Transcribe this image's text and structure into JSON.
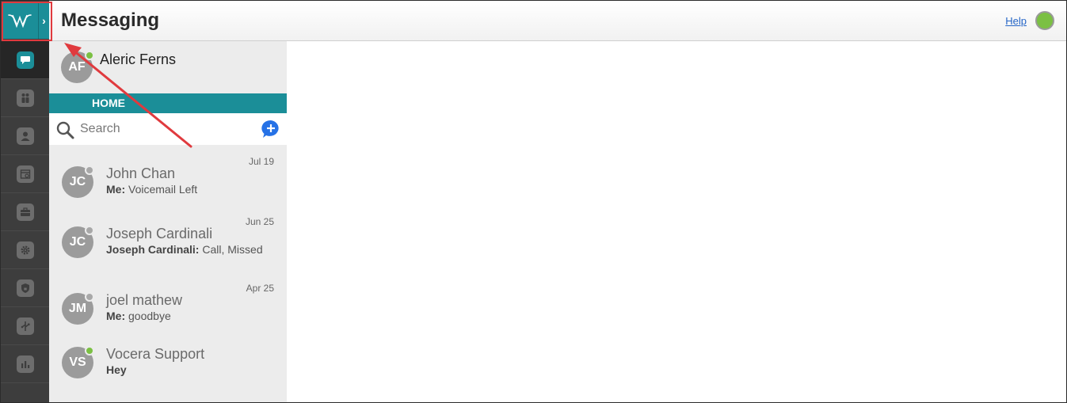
{
  "header": {
    "title": "Messaging",
    "help_label": "Help",
    "status_color": "#7bc043"
  },
  "rail": {
    "logo_icon": "vocera-logo-icon",
    "expand_icon": "chevron-right-icon",
    "items": [
      {
        "icon": "chat-icon",
        "active": true
      },
      {
        "icon": "people-icon",
        "active": false
      },
      {
        "icon": "person-icon",
        "active": false
      },
      {
        "icon": "calendar-icon",
        "active": false
      },
      {
        "icon": "briefcase-icon",
        "active": false
      },
      {
        "icon": "gear-icon",
        "active": false
      },
      {
        "icon": "shield-icon",
        "active": false
      },
      {
        "icon": "network-icon",
        "active": false
      },
      {
        "icon": "chart-icon",
        "active": false
      }
    ],
    "accent": "#1b8e98"
  },
  "me": {
    "initials": "AF",
    "name": "Aleric Ferns",
    "presence": "online"
  },
  "home_label": "HOME",
  "search": {
    "placeholder": "Search",
    "value": ""
  },
  "conversations": [
    {
      "initials": "JC",
      "name": "John Chan",
      "sender": "Me:",
      "preview": "Voicemail Left",
      "date": "Jul 19",
      "presence": "offline"
    },
    {
      "initials": "JC",
      "name": "Joseph Cardinali",
      "sender": "Joseph Cardinali:",
      "preview": "Call, Missed",
      "date": "Jun 25",
      "presence": "offline"
    },
    {
      "initials": "JM",
      "name": "joel mathew",
      "sender": "Me:",
      "preview": "goodbye",
      "date": "Apr 25",
      "presence": "offline"
    },
    {
      "initials": "VS",
      "name": "Vocera Support",
      "sender": "",
      "preview": "Hey",
      "date": "",
      "presence": "online"
    }
  ]
}
